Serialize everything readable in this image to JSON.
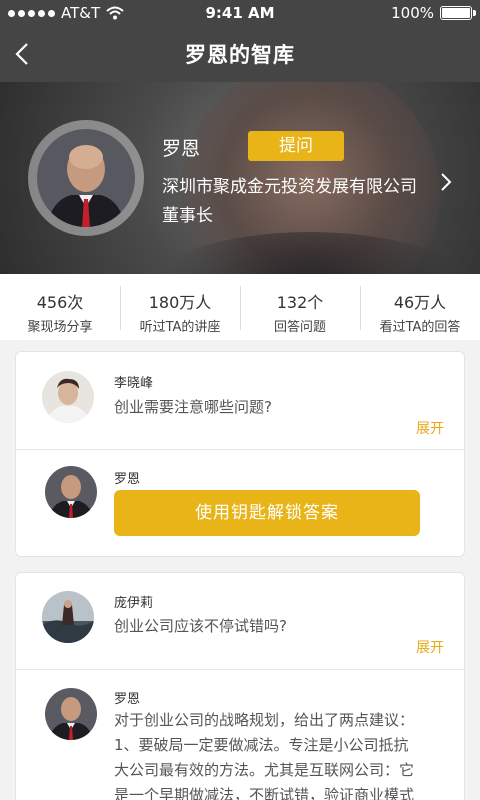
{
  "status_bar": {
    "carrier": "AT&T",
    "time": "9:41 AM",
    "battery": "100%"
  },
  "nav": {
    "title": "罗恩的智库",
    "back_icon": "chevron-left-icon"
  },
  "profile": {
    "name": "罗恩",
    "ask_label": "提问",
    "company": "深圳市聚成金元投资发展有限公司",
    "role": "董事长"
  },
  "stats": [
    {
      "value": "456次",
      "label": "聚现场分享"
    },
    {
      "value": "180万人",
      "label": "听过TA的讲座"
    },
    {
      "value": "132个",
      "label": "回答问题"
    },
    {
      "value": "46万人",
      "label": "看过TA的回答"
    }
  ],
  "questions": [
    {
      "asker": "李晓峰",
      "question": "创业需要注意哪些问题?",
      "expand_label": "展开",
      "answerer": "罗恩",
      "unlock_label": "使用钥匙解锁答案"
    },
    {
      "asker": "庞伊莉",
      "question": "创业公司应该不停试错吗?",
      "expand_label": "展开",
      "answerer": "罗恩",
      "answer_lines": [
        "对于创业公司的战略规划，给出了两点建议：",
        "1、要破局一定要做减法。专注是小公司抵抗",
        "大公司最有效的方法。尤其是互联网公司：它",
        "是一个早期做减法，不断试错，验证商业模式"
      ]
    }
  ],
  "colors": {
    "accent": "#e8b418",
    "expand": "#e8a818",
    "topbar": "#454545"
  }
}
